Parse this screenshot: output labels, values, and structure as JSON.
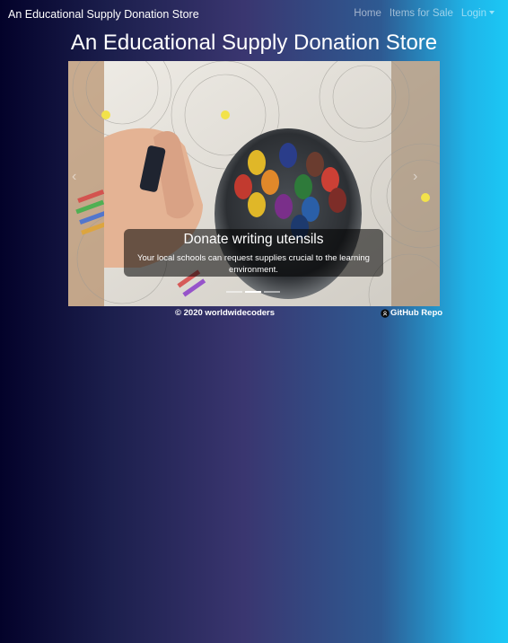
{
  "navbar": {
    "brand": "An Educational Supply Donation Store",
    "links": [
      {
        "label": "Home"
      },
      {
        "label": "Items for Sale"
      },
      {
        "label": "Login"
      }
    ]
  },
  "header": {
    "title": "An Educational Supply Donation Store"
  },
  "carousel": {
    "slide_title": "Donate writing utensils",
    "slide_text": "Your local schools can request supplies crucial to the learning environment.",
    "active_index": 1,
    "slide_count": 3
  },
  "footer": {
    "copyright": "© 2020 worldwidecoders",
    "repo_link": "GitHub Repo",
    "repo_icon": "github-icon"
  },
  "colors": {
    "gradient_left": "#03022a",
    "gradient_mid": "#3a3670",
    "gradient_right": "#1bc8f5"
  }
}
